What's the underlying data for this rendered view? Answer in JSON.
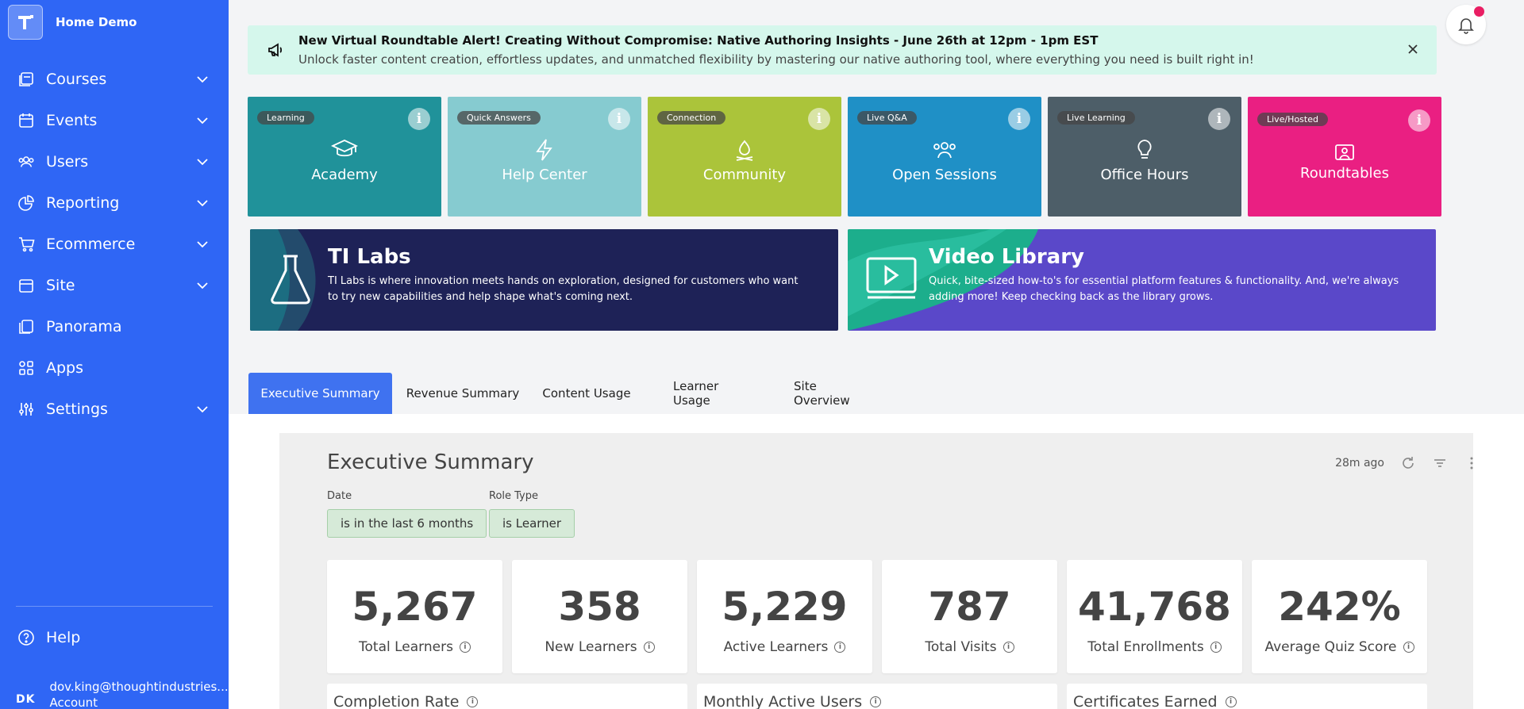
{
  "brand": {
    "name": "Home Demo"
  },
  "sidebar": {
    "items": [
      {
        "label": "Courses",
        "icon": "courses-icon",
        "expandable": true
      },
      {
        "label": "Events",
        "icon": "calendar-icon",
        "expandable": true
      },
      {
        "label": "Users",
        "icon": "users-icon",
        "expandable": true
      },
      {
        "label": "Reporting",
        "icon": "pie-chart-icon",
        "expandable": true
      },
      {
        "label": "Ecommerce",
        "icon": "cart-icon",
        "expandable": true
      },
      {
        "label": "Site",
        "icon": "site-icon",
        "expandable": true
      },
      {
        "label": "Panorama",
        "icon": "panorama-icon",
        "expandable": false
      },
      {
        "label": "Apps",
        "icon": "apps-icon",
        "expandable": false
      },
      {
        "label": "Settings",
        "icon": "sliders-icon",
        "expandable": true
      }
    ],
    "help_label": "Help",
    "user": {
      "initials": "DK",
      "email": "dov.king@thoughtindustries...",
      "account_label": "Account"
    }
  },
  "banner": {
    "title": "New Virtual Roundtable Alert! Creating Without Compromise: Native Authoring Insights - June 26th at 12pm - 1pm EST",
    "text": "Unlock faster content creation, effortless updates, and unmatched flexibility by mastering our native authoring tool, where everything you need is built right in!"
  },
  "tiles": [
    {
      "badge": "Learning",
      "label": "Academy",
      "color": "#20929a",
      "icon": "graduation-cap-icon"
    },
    {
      "badge": "Quick Answers",
      "label": "Help Center",
      "color": "#86cbd0",
      "icon": "lightning-icon"
    },
    {
      "badge": "Connection",
      "label": "Community",
      "color": "#abc43a",
      "icon": "campfire-icon"
    },
    {
      "badge": "Live Q&A",
      "label": "Open Sessions",
      "color": "#1f90c6",
      "icon": "people-icon"
    },
    {
      "badge": "Live Learning",
      "label": "Office Hours",
      "color": "#4d5e68",
      "icon": "lightbulb-icon"
    },
    {
      "badge": "Live/Hosted",
      "label": "Roundtables",
      "color": "#ea1f82",
      "icon": "roundtable-icon"
    }
  ],
  "promos": [
    {
      "title": "TI Labs",
      "text": "TI Labs is where innovation meets hands on exploration, designed for customers who want to try new capabilities and help shape what's coming next.",
      "icon": "flask-icon"
    },
    {
      "title": "Video Library",
      "text": "Quick, bite-sized how-to's for essential platform features & functionality. And, we're always adding more! Keep checking back as the library grows.",
      "icon": "video-play-icon"
    }
  ],
  "tabs": [
    {
      "label": "Executive Summary",
      "active": true
    },
    {
      "label": "Revenue Summary",
      "active": false
    },
    {
      "label": "Content Usage",
      "active": false
    },
    {
      "label": "Learner Usage",
      "active": false
    },
    {
      "label": "Site Overview",
      "active": false
    }
  ],
  "dashboard": {
    "title": "Executive Summary",
    "updated": "28m ago",
    "filters": [
      {
        "label": "Date",
        "value": "is in the last 6 months"
      },
      {
        "label": "Role Type",
        "value": "is Learner"
      }
    ],
    "kpis": [
      {
        "value": "5,267",
        "label": "Total Learners"
      },
      {
        "value": "358",
        "label": "New Learners"
      },
      {
        "value": "5,229",
        "label": "Active Learners"
      },
      {
        "value": "787",
        "label": "Total Visits"
      },
      {
        "value": "41,768",
        "label": "Total Enrollments"
      },
      {
        "value": "242%",
        "label": "Average Quiz Score"
      }
    ],
    "cards": [
      {
        "title": "Completion Rate"
      },
      {
        "title": "Monthly Active Users"
      },
      {
        "title": "Certificates Earned"
      }
    ]
  },
  "colors": {
    "sidebar": "#2f66f5",
    "tab_active": "#3f72f0",
    "banner_bg": "#d5f7ec",
    "notification_dot": "#e91e63",
    "promo_labs": "#1e2257",
    "promo_video": "#5a48c9"
  }
}
